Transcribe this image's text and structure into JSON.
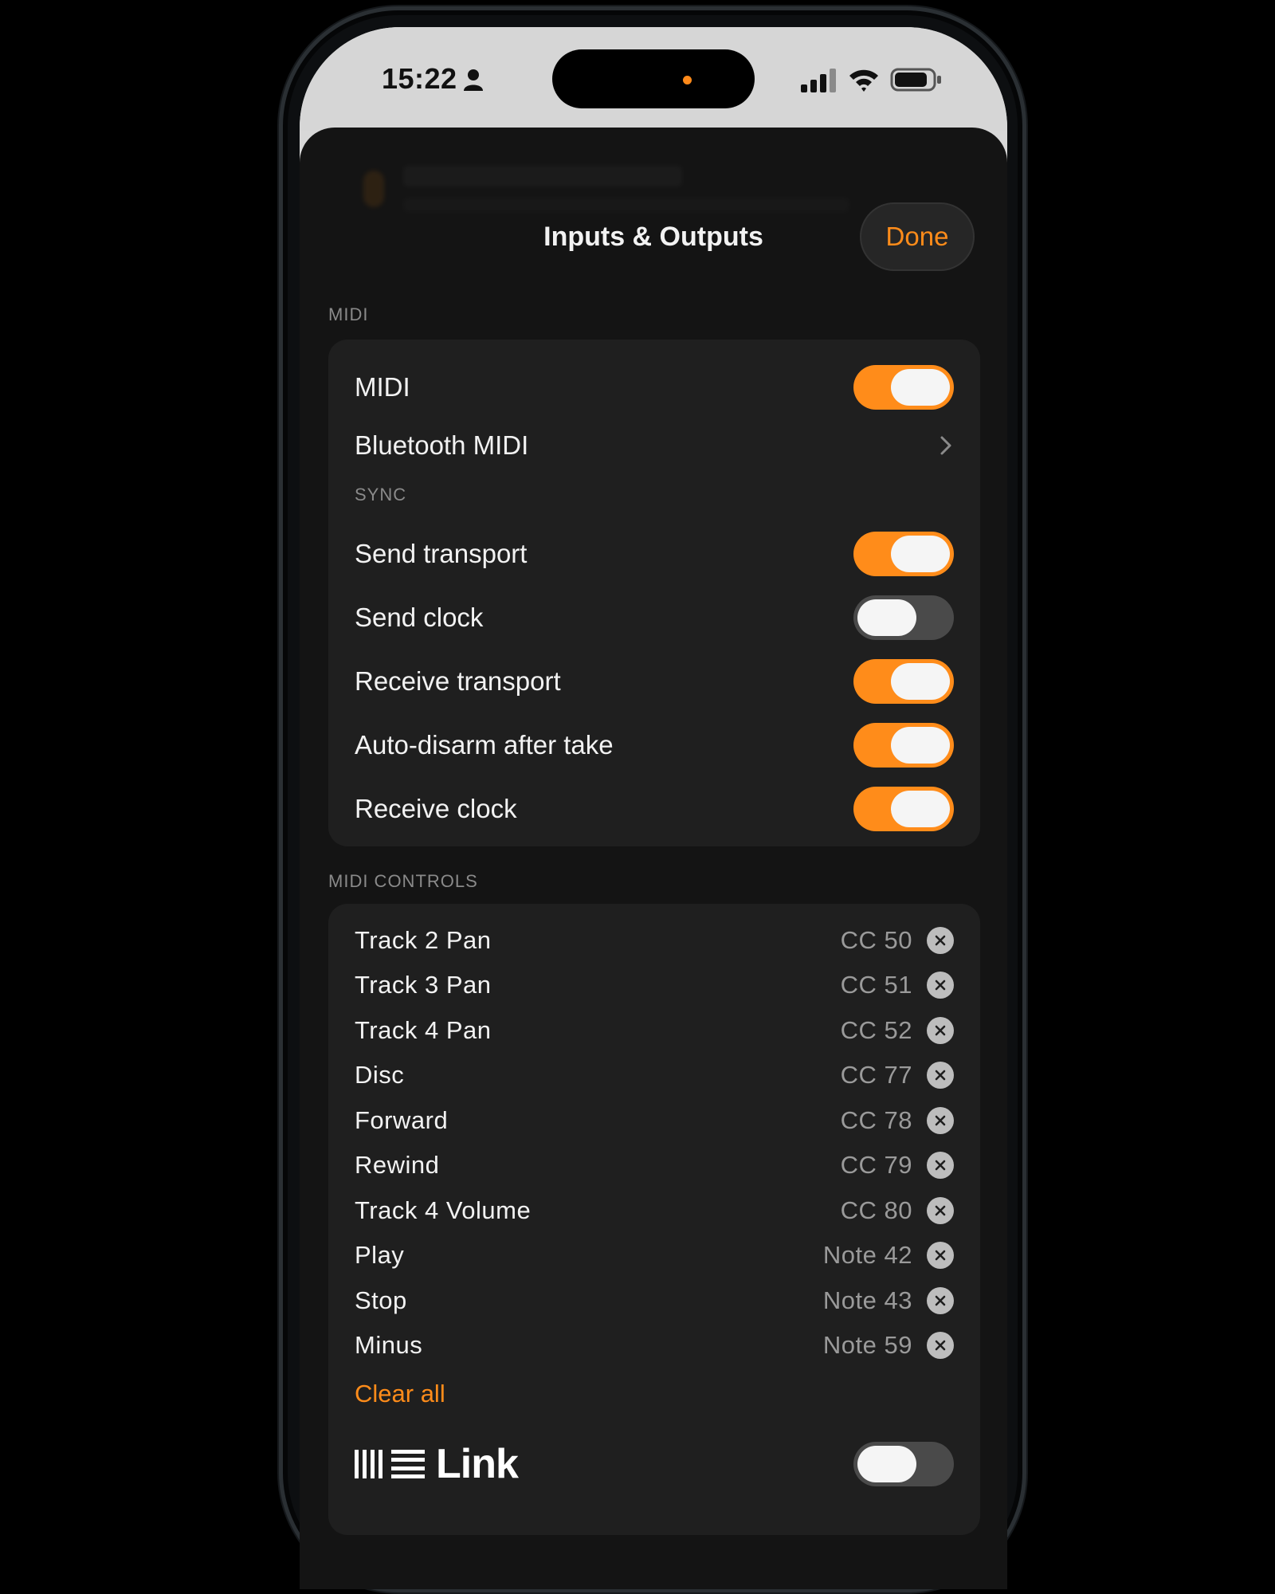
{
  "status_bar": {
    "time": "15:22"
  },
  "sheet": {
    "title": "Inputs & Outputs",
    "done_label": "Done"
  },
  "midi_section": {
    "header": "MIDI",
    "midi": {
      "label": "MIDI",
      "enabled": true
    },
    "bluetooth": {
      "label": "Bluetooth MIDI"
    },
    "sync_header": "SYNC",
    "sync_items": [
      {
        "label": "Send transport",
        "enabled": true
      },
      {
        "label": "Send clock",
        "enabled": false
      },
      {
        "label": "Receive transport",
        "enabled": true
      },
      {
        "label": "Auto-disarm after take",
        "enabled": true
      },
      {
        "label": "Receive clock",
        "enabled": true
      }
    ]
  },
  "midi_controls": {
    "header": "MIDI CONTROLS",
    "items": [
      {
        "label": "Track 2 Pan",
        "value": "CC 50"
      },
      {
        "label": "Track 3 Pan",
        "value": "CC 51"
      },
      {
        "label": "Track 4 Pan",
        "value": "CC 52"
      },
      {
        "label": "Disc",
        "value": "CC 77"
      },
      {
        "label": "Forward",
        "value": "CC 78"
      },
      {
        "label": "Rewind",
        "value": "CC 79"
      },
      {
        "label": "Track 4 Volume",
        "value": "CC 80"
      },
      {
        "label": "Play",
        "value": "Note 42"
      },
      {
        "label": "Stop",
        "value": "Note 43"
      },
      {
        "label": "Minus",
        "value": "Note 59"
      }
    ],
    "clear_all_label": "Clear all"
  },
  "link": {
    "label": "Link",
    "enabled": false
  },
  "colors": {
    "accent": "#ff8c1a",
    "toggle_off": "#4a4a4a",
    "card": "#1f1f1f",
    "sheet": "#141414"
  }
}
